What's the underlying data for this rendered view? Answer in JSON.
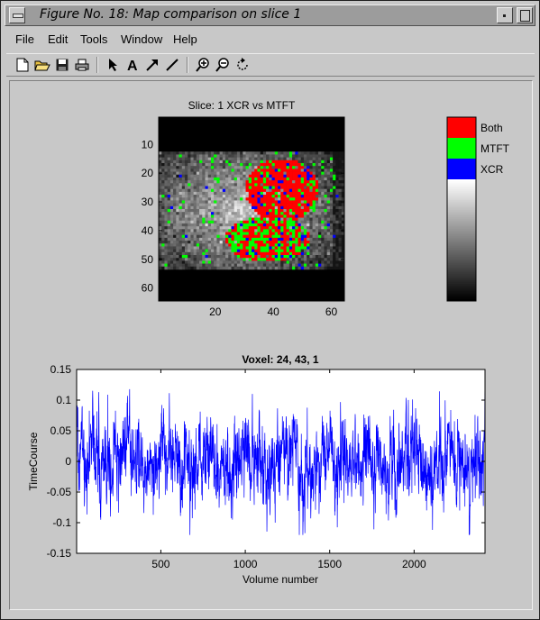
{
  "window": {
    "title": "Figure No. 18: Map comparison on slice 1"
  },
  "menu": [
    "File",
    "Edit",
    "Tools",
    "Window",
    "Help"
  ],
  "toolbar_icons": [
    "new-file-icon",
    "open-folder-icon",
    "save-icon",
    "print-icon",
    "pointer-icon",
    "text-icon",
    "arrow-icon",
    "line-icon",
    "zoom-in-icon",
    "zoom-out-icon",
    "rotate-icon"
  ],
  "map_plot": {
    "title": "Slice: 1 XCR vs MTFT",
    "x_ticks": [
      "20",
      "40",
      "60"
    ],
    "y_ticks": [
      "10",
      "20",
      "30",
      "40",
      "50",
      "60"
    ],
    "legend": [
      {
        "label": "Both",
        "color": "#ff0000"
      },
      {
        "label": "MTFT",
        "color": "#00ff00"
      },
      {
        "label": "XCR",
        "color": "#0000ff"
      }
    ]
  },
  "chart_data": {
    "type": "line",
    "title": "Voxel: 24, 43, 1",
    "xlabel": "Volume number",
    "ylabel": "TimeCourse",
    "xlim": [
      1,
      2420
    ],
    "ylim": [
      -0.15,
      0.15
    ],
    "x_ticks": [
      500,
      1000,
      1500,
      2000
    ],
    "y_ticks": [
      -0.15,
      -0.1,
      -0.05,
      0,
      0.05,
      0.1,
      0.15
    ],
    "x_tick_labels": [
      "500",
      "1000",
      "1500",
      "2000"
    ],
    "y_tick_labels": [
      "-0.15",
      "-0.1",
      "-0.05",
      "0",
      "0.05",
      "0.1",
      "0.15"
    ],
    "color": "#0000ff",
    "n_points": 2420,
    "value_range": [
      -0.12,
      0.14
    ],
    "note_series": "noisy oscillating signal around 0"
  }
}
